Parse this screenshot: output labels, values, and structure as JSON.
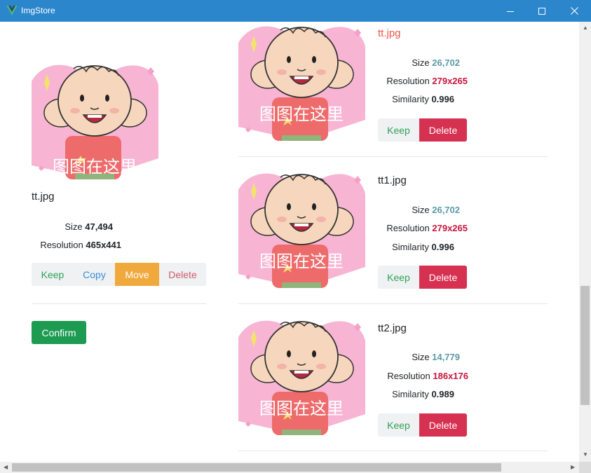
{
  "window": {
    "title": "ImgStore",
    "logo_icon": "vue-logo-icon",
    "controls": [
      "minimize-icon",
      "maximize-icon",
      "close-icon"
    ]
  },
  "colors": {
    "titlebar": "#2b86cc",
    "keep": "#2fa25a",
    "copy": "#3d8ed8",
    "move": "#f0a93c",
    "delete": "#d63151",
    "confirm": "#1c9b51",
    "size_value": "#5b9aa6",
    "resolution_value": "#c7163f"
  },
  "original": {
    "filename": "tt.jpg",
    "size_label": "Size",
    "size_value": "47,494",
    "resolution_label": "Resolution",
    "resolution_value": "465x441",
    "actions": {
      "keep": "Keep",
      "copy": "Copy",
      "move": "Move",
      "delete": "Delete"
    },
    "confirm": "Confirm",
    "image_watermark": "图图在这里"
  },
  "duplicates": [
    {
      "filename": "tt.jpg",
      "size_label": "Size",
      "size_value": "26,702",
      "resolution_label": "Resolution",
      "resolution_value": "279x265",
      "similarity_label": "Similarity",
      "similarity_value": "0.996",
      "keep": "Keep",
      "delete": "Delete",
      "image_watermark": "图图在这里"
    },
    {
      "filename": "tt1.jpg",
      "size_label": "Size",
      "size_value": "26,702",
      "resolution_label": "Resolution",
      "resolution_value": "279x265",
      "similarity_label": "Similarity",
      "similarity_value": "0.996",
      "keep": "Keep",
      "delete": "Delete",
      "image_watermark": "图图在这里"
    },
    {
      "filename": "tt2.jpg",
      "size_label": "Size",
      "size_value": "14,779",
      "resolution_label": "Resolution",
      "resolution_value": "186x176",
      "similarity_label": "Similarity",
      "similarity_value": "0.989",
      "keep": "Keep",
      "delete": "Delete",
      "image_watermark": "图图在这里"
    }
  ],
  "scrollbars": {
    "vertical_icons": [
      "scroll-up-arrow-icon",
      "scroll-down-arrow-icon"
    ],
    "horizontal_icons": [
      "scroll-left-arrow-icon",
      "scroll-right-arrow-icon"
    ]
  }
}
